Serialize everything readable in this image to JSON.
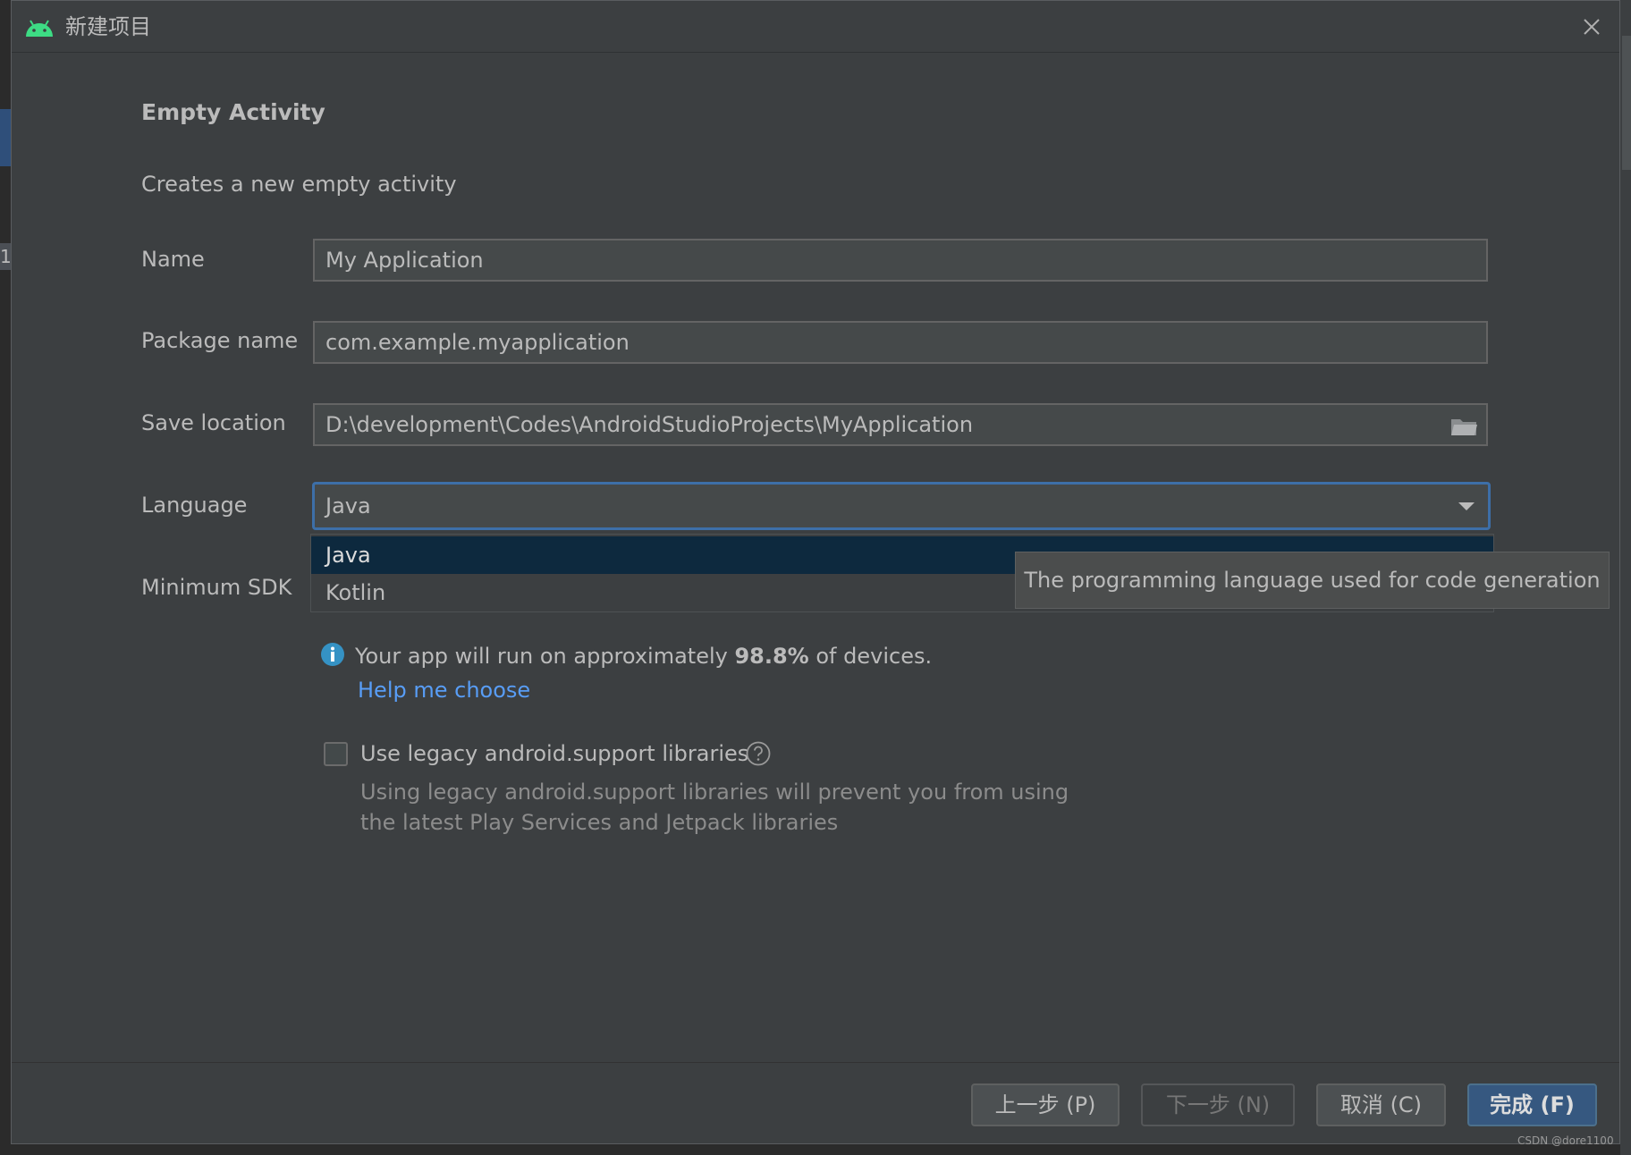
{
  "window": {
    "title": "新建项目"
  },
  "template": {
    "heading": "Empty Activity",
    "description": "Creates a new empty activity"
  },
  "form": {
    "name": {
      "label": "Name",
      "value": "My Application"
    },
    "package": {
      "label": "Package name",
      "value": "com.example.myapplication"
    },
    "save_location": {
      "label": "Save location",
      "value": "D:\\development\\Codes\\AndroidStudioProjects\\MyApplication"
    },
    "language": {
      "label": "Language",
      "selected": "Java",
      "options": [
        "Java",
        "Kotlin"
      ],
      "tooltip": "The programming language used for code generation"
    },
    "min_sdk": {
      "label": "Minimum SDK"
    }
  },
  "info": {
    "text_before": "Your app will run on approximately ",
    "percent": "98.8%",
    "text_after": " of devices.",
    "help_link": "Help me choose"
  },
  "legacy": {
    "checked": false,
    "label": "Use legacy android.support libraries",
    "hint_line1": "Using legacy android.support libraries will prevent you from using",
    "hint_line2": "the latest Play Services and Jetpack libraries"
  },
  "footer": {
    "previous": "上一步 (P)",
    "next": "下一步 (N)",
    "cancel": "取消 (C)",
    "finish": "完成 (F)"
  },
  "watermark": "CSDN @dore1100",
  "background": {
    "side_number": "1"
  },
  "colors": {
    "dialog_bg": "#3c3f41",
    "accent": "#3d6fa8",
    "link": "#589df6",
    "android_green": "#3ddc84",
    "info_blue": "#3592c4"
  }
}
